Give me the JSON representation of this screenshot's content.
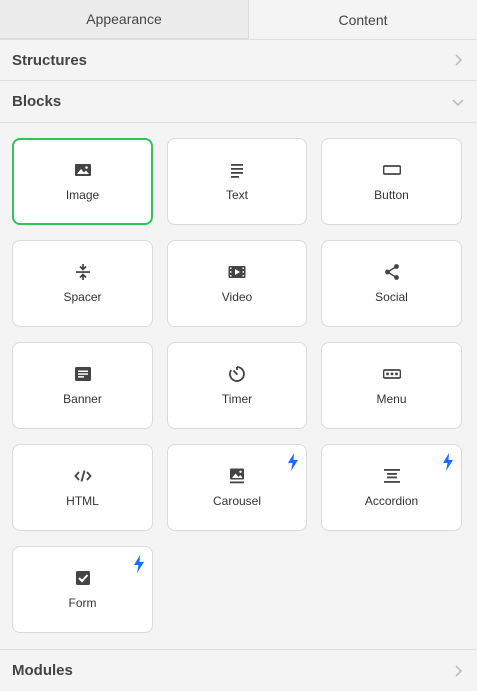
{
  "tabs": {
    "appearance": "Appearance",
    "content": "Content"
  },
  "sections": {
    "structures": "Structures",
    "blocks": "Blocks",
    "modules": "Modules"
  },
  "accent": "#33c15a",
  "bolt_color": "#1f6bff",
  "blocks": [
    {
      "label": "Image",
      "icon": "image-icon"
    },
    {
      "label": "Text",
      "icon": "text-icon"
    },
    {
      "label": "Button",
      "icon": "button-icon"
    },
    {
      "label": "Spacer",
      "icon": "spacer-icon"
    },
    {
      "label": "Video",
      "icon": "video-icon"
    },
    {
      "label": "Social",
      "icon": "share-icon"
    },
    {
      "label": "Banner",
      "icon": "banner-icon"
    },
    {
      "label": "Timer",
      "icon": "timer-icon"
    },
    {
      "label": "Menu",
      "icon": "menu-icon"
    },
    {
      "label": "HTML",
      "icon": "code-icon"
    },
    {
      "label": "Carousel",
      "icon": "carousel-icon"
    },
    {
      "label": "Accordion",
      "icon": "accordion-icon"
    },
    {
      "label": "Form",
      "icon": "checkbox-icon"
    }
  ]
}
